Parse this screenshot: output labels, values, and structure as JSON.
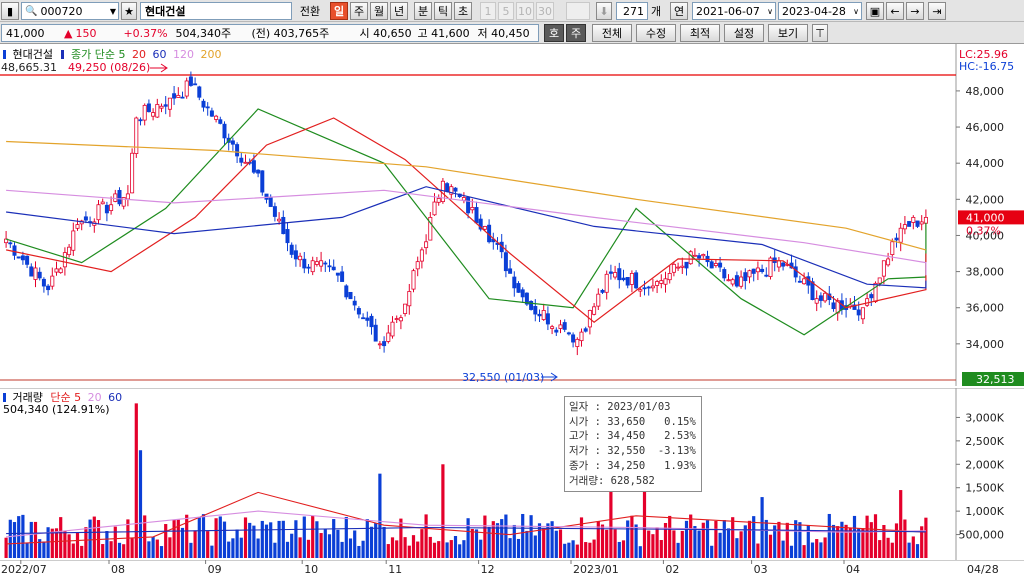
{
  "toolbar": {
    "code": "000720",
    "name": "현대건설",
    "switch": "전환",
    "periods": [
      "일",
      "주",
      "월",
      "년",
      "분",
      "틱",
      "초"
    ],
    "minutes": [
      "1",
      "5",
      "10",
      "30"
    ],
    "count": "271",
    "count_unit": "개",
    "year_label": "연",
    "date_from": "2021-06-07",
    "date_to": "2023-04-28"
  },
  "quote": {
    "price": "41,000",
    "change": "150",
    "rate": "+0.37%",
    "volume": "504,340주",
    "prev_volume": "(전) 403,765주",
    "open": "시 40,650",
    "high": "고 41,600",
    "low": "저 40,450"
  },
  "toolbar2": {
    "ho": "호",
    "ju": "주",
    "menus": [
      "전체",
      "수정",
      "최적",
      "설정",
      "보기"
    ]
  },
  "price_legend": {
    "name": "현대건설",
    "ma_label": "종가 단순",
    "ma_periods": [
      "5",
      "20",
      "60",
      "120",
      "200"
    ]
  },
  "price_axis": {
    "ticks": [
      "48,000",
      "46,000",
      "44,000",
      "42,000",
      "40,000",
      "38,000",
      "36,000",
      "34,000"
    ],
    "lc": "LC:25.96",
    "hc": "HC:-16.75",
    "current": "41,000",
    "current_rate": "0.37%",
    "level_box": "32,513"
  },
  "annotations": {
    "max_level": "48,665.31",
    "high": "49,250 (08/26)",
    "low": "32,550 (01/03)"
  },
  "volume_legend": {
    "name": "거래량",
    "ma_label": "단순",
    "ma_periods": [
      "5",
      "20",
      "60"
    ],
    "value": "504,340 (124.91%)"
  },
  "volume_axis": {
    "ticks": [
      "3,000K",
      "2,500K",
      "2,000K",
      "1,500K",
      "1,000K",
      "500,000"
    ]
  },
  "date_axis": {
    "labels": [
      "2022/07",
      "08",
      "09",
      "10",
      "11",
      "12",
      "2023/01",
      "02",
      "03",
      "04",
      "04/28"
    ]
  },
  "tooltip": {
    "rows": [
      "일자 : 2023/01/03",
      "시가 : 33,650   0.15%",
      "고가 : 34,450   2.53%",
      "저가 : 32,550  -3.13%",
      "종가 : 34,250   1.93%",
      "거래량: 628,582"
    ]
  },
  "colors": {
    "up": "#e4002b",
    "down": "#0b3fd6",
    "ma5": "#1f8c1f",
    "ma20": "#e21f1f",
    "ma60": "#1b2fb8",
    "ma120": "#d68de0",
    "ma200": "#e3a32b"
  },
  "chart_data": {
    "type": "candlestick",
    "x_range": [
      "2022-06-27",
      "2023-04-28"
    ],
    "ylim": [
      32000,
      49600
    ],
    "y_ticks": [
      34000,
      36000,
      38000,
      40000,
      42000,
      44000,
      46000,
      48000
    ],
    "anchors": [
      {
        "date": "2022-06-27",
        "close": 39800
      },
      {
        "date": "2022-07-11",
        "close": 37000
      },
      {
        "date": "2022-07-20",
        "close": 40600
      },
      {
        "date": "2022-08-05",
        "close": 42300
      },
      {
        "date": "2022-08-09",
        "close": 46500
      },
      {
        "date": "2022-08-19",
        "close": 47600
      },
      {
        "date": "2022-08-26",
        "close": 48300
      },
      {
        "date": "2022-09-16",
        "close": 43500
      },
      {
        "date": "2022-09-30",
        "close": 38700
      },
      {
        "date": "2022-10-14",
        "close": 37800
      },
      {
        "date": "2022-10-28",
        "close": 34000
      },
      {
        "date": "2022-11-07",
        "close": 36200
      },
      {
        "date": "2022-11-18",
        "close": 43000
      },
      {
        "date": "2022-12-02",
        "close": 40500
      },
      {
        "date": "2022-12-16",
        "close": 36200
      },
      {
        "date": "2022-12-29",
        "close": 34800
      },
      {
        "date": "2023-01-03",
        "close": 34250
      },
      {
        "date": "2023-01-13",
        "close": 37900
      },
      {
        "date": "2023-01-27",
        "close": 37200
      },
      {
        "date": "2023-02-10",
        "close": 38900
      },
      {
        "date": "2023-02-24",
        "close": 37200
      },
      {
        "date": "2023-03-10",
        "close": 38600
      },
      {
        "date": "2023-03-24",
        "close": 36400
      },
      {
        "date": "2023-04-07",
        "close": 36000
      },
      {
        "date": "2023-04-20",
        "close": 40400
      },
      {
        "date": "2023-04-28",
        "close": 41000
      }
    ],
    "moving_averages": [
      {
        "name": "5",
        "points": [
          [
            0,
            39800
          ],
          [
            18,
            38500
          ],
          [
            38,
            41500
          ],
          [
            60,
            47000
          ],
          [
            90,
            44000
          ],
          [
            115,
            36500
          ],
          [
            135,
            36000
          ],
          [
            150,
            41500
          ],
          [
            175,
            36500
          ],
          [
            190,
            34500
          ],
          [
            210,
            37600
          ],
          [
            240,
            37700
          ],
          [
            270,
            40700
          ]
        ]
      },
      {
        "name": "20",
        "points": [
          [
            0,
            39200
          ],
          [
            25,
            38000
          ],
          [
            45,
            41000
          ],
          [
            62,
            45000
          ],
          [
            78,
            46500
          ],
          [
            95,
            44200
          ],
          [
            120,
            39000
          ],
          [
            140,
            35200
          ],
          [
            160,
            38700
          ],
          [
            185,
            38600
          ],
          [
            200,
            36000
          ],
          [
            220,
            37000
          ],
          [
            250,
            37100
          ],
          [
            271,
            39000
          ]
        ]
      },
      {
        "name": "60",
        "points": [
          [
            0,
            41300
          ],
          [
            40,
            40100
          ],
          [
            80,
            41000
          ],
          [
            100,
            42700
          ],
          [
            140,
            40500
          ],
          [
            180,
            39500
          ],
          [
            205,
            37300
          ],
          [
            230,
            37100
          ],
          [
            250,
            37100
          ],
          [
            271,
            37500
          ]
        ]
      },
      {
        "name": "120",
        "points": [
          [
            0,
            42500
          ],
          [
            40,
            41800
          ],
          [
            90,
            42500
          ],
          [
            140,
            41000
          ],
          [
            190,
            39600
          ],
          [
            230,
            38500
          ],
          [
            271,
            37800
          ]
        ]
      },
      {
        "name": "200",
        "points": [
          [
            0,
            45200
          ],
          [
            50,
            44700
          ],
          [
            100,
            43800
          ],
          [
            150,
            42000
          ],
          [
            200,
            40400
          ],
          [
            240,
            39200
          ],
          [
            271,
            39200
          ]
        ]
      }
    ],
    "volume_ma": [
      {
        "name": "5",
        "points": [
          [
            0,
            300000
          ],
          [
            35,
            450000
          ],
          [
            60,
            1400000
          ],
          [
            90,
            700000
          ],
          [
            120,
            500000
          ],
          [
            150,
            900000
          ],
          [
            190,
            700000
          ],
          [
            230,
            550000
          ],
          [
            271,
            550000
          ]
        ]
      },
      {
        "name": "20",
        "points": [
          [
            0,
            450000
          ],
          [
            60,
            1000000
          ],
          [
            100,
            700000
          ],
          [
            150,
            650000
          ],
          [
            200,
            550000
          ],
          [
            271,
            580000
          ]
        ]
      },
      {
        "name": "60",
        "points": [
          [
            0,
            520000
          ],
          [
            100,
            650000
          ],
          [
            180,
            600000
          ],
          [
            271,
            560000
          ]
        ]
      }
    ],
    "volume_ylim": [
      0,
      3500000
    ],
    "volume_spikes": [
      {
        "date": "2022-08-09",
        "value": 3300000
      },
      {
        "date": "2022-08-10",
        "value": 2300000
      },
      {
        "date": "2022-10-28",
        "value": 1800000
      },
      {
        "date": "2022-11-18",
        "value": 2000000
      },
      {
        "date": "2023-01-13",
        "value": 1700000
      },
      {
        "date": "2023-01-25",
        "value": 1600000
      },
      {
        "date": "2023-03-06",
        "value": 1300000
      },
      {
        "date": "2023-04-20",
        "value": 1450000
      }
    ]
  }
}
